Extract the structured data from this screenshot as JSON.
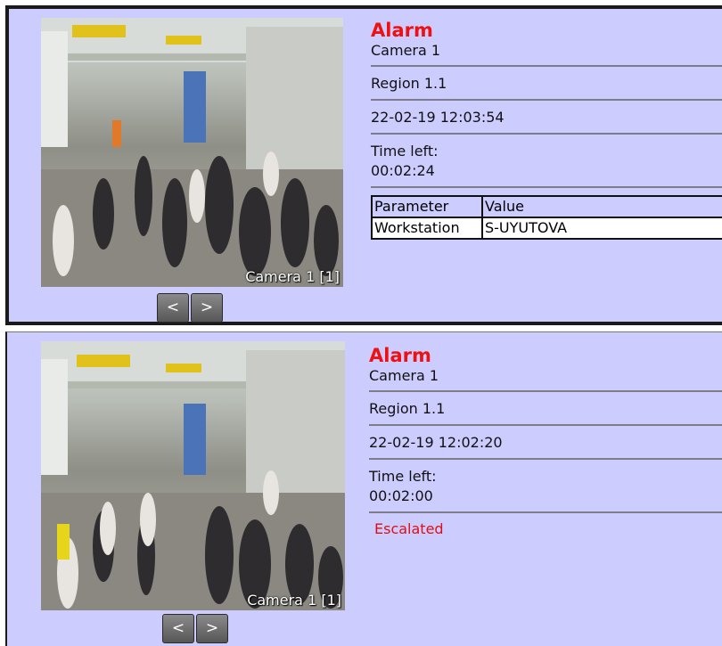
{
  "alarms": [
    {
      "title": "Alarm",
      "camera": "Camera 1",
      "region": "Region 1.1",
      "datetime": "22-02-19 12:03:54",
      "time_left_label": "Time left:",
      "time_left": "00:02:24",
      "overlay": "Camera 1 [1]",
      "nav": {
        "prev": "<",
        "next": ">"
      },
      "params": {
        "headers": [
          "Parameter",
          "Value"
        ],
        "rows": [
          [
            "Workstation",
            "S-UYUTOVA"
          ]
        ]
      }
    },
    {
      "title": "Alarm",
      "camera": "Camera 1",
      "region": "Region 1.1",
      "datetime": "22-02-19 12:02:20",
      "time_left_label": "Time left:",
      "time_left": "00:02:00",
      "status": "Escalated",
      "overlay": "Camera 1 [1]",
      "nav": {
        "prev": "<",
        "next": ">"
      }
    }
  ],
  "colors": {
    "card_bg": "#ccccff",
    "alarm_title": "#ee1111",
    "escalated": "#dd1111"
  },
  "icons": {
    "prev": "chevron-left-icon",
    "next": "chevron-right-icon"
  }
}
